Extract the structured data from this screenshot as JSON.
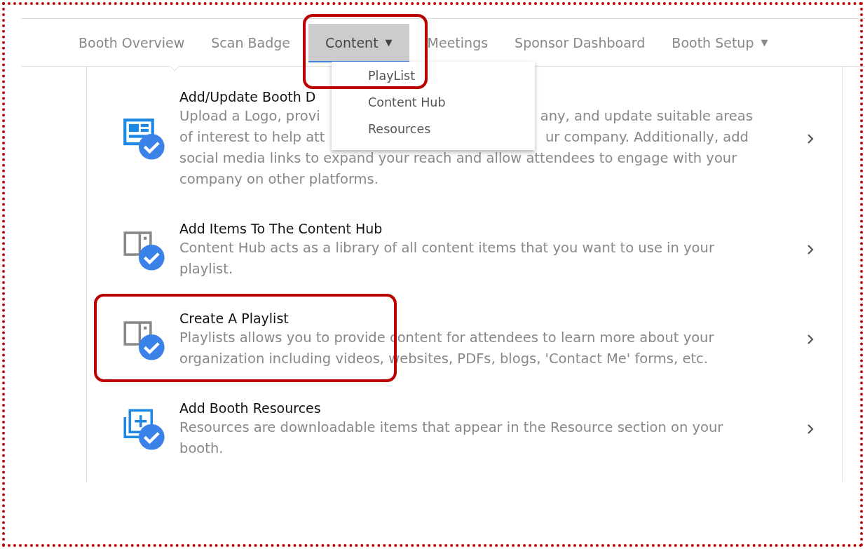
{
  "nav": {
    "tabs": [
      {
        "label": "Booth Overview",
        "selected": false
      },
      {
        "label": "Scan Badge",
        "selected": false
      },
      {
        "label": "Content",
        "selected": true,
        "caret": "▼",
        "highlighted": true
      },
      {
        "label": "Meetings",
        "selected": false
      },
      {
        "label": "Sponsor Dashboard",
        "selected": false
      },
      {
        "label": "Booth Setup",
        "selected": false,
        "caret": "▼"
      }
    ]
  },
  "dropdown_menu": {
    "items": [
      {
        "label": "PlayList"
      },
      {
        "label": "Content Hub"
      },
      {
        "label": "Resources"
      }
    ]
  },
  "tasks": [
    {
      "kind": "layout",
      "title": "Add/Update Booth D",
      "description_lines": [
        [
          "Upload a Logo, provi",
          "any, and update suitable areas"
        ],
        [
          "of interest to help att",
          "ur company. Additionally, add"
        ],
        [
          "social media links to expand your reach and allow attendees to engage with your"
        ],
        [
          "company on other platforms."
        ]
      ]
    },
    {
      "kind": "book",
      "title": "Add Items To The Content Hub",
      "description": "Content Hub acts as a library of all content items that you want to use in your playlist."
    },
    {
      "kind": "book",
      "title": "Create A Playlist",
      "description": "Playlists allows you to provide content for attendees to learn more about your organization including videos, websites, PDFs, blogs, 'Contact Me' forms, etc.",
      "highlighted": true
    },
    {
      "kind": "resource",
      "title": "Add Booth Resources",
      "description": "Resources are downloadable items that appear in the Resource section on your booth."
    }
  ]
}
